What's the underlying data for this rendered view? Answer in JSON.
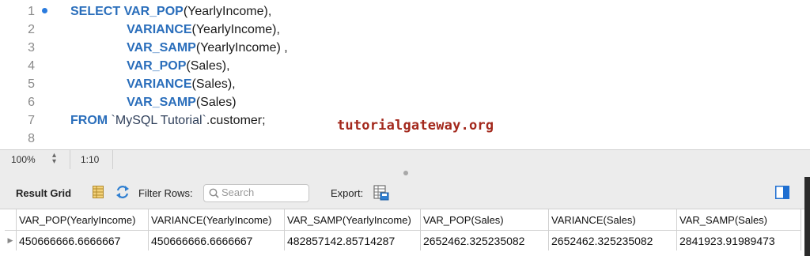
{
  "editor": {
    "line_numbers": [
      "1",
      "2",
      "3",
      "4",
      "5",
      "6",
      "7",
      "8"
    ],
    "lines": [
      {
        "kw": "SELECT ",
        "pre": "",
        "fn": "VAR_POP",
        "rest": "(YearlyIncome),"
      },
      {
        "kw": "",
        "pre": "                ",
        "fn": "VARIANCE",
        "rest": "(YearlyIncome),"
      },
      {
        "kw": "",
        "pre": "                ",
        "fn": "VAR_SAMP",
        "rest": "(YearlyIncome) ,"
      },
      {
        "kw": "",
        "pre": "                ",
        "fn": "VAR_POP",
        "rest": "(Sales),"
      },
      {
        "kw": "",
        "pre": "                ",
        "fn": "VARIANCE",
        "rest": "(Sales),"
      },
      {
        "kw": "",
        "pre": "                ",
        "fn": "VAR_SAMP",
        "rest": "(Sales)"
      },
      {
        "kw": "FROM ",
        "pre": "",
        "fn": "",
        "str": "`MySQL Tutorial`",
        "rest": ".customer;"
      }
    ],
    "watermark": "tutorialgateway.org"
  },
  "statusbar": {
    "zoom": "100%",
    "cursor_position": "1:10"
  },
  "toolbar": {
    "result_grid_label": "Result Grid",
    "filter_rows_label": "Filter Rows:",
    "search_placeholder": "Search",
    "export_label": "Export:"
  },
  "results": {
    "columns": [
      "VAR_POP(YearlyIncome)",
      "VARIANCE(YearlyIncome)",
      "VAR_SAMP(YearlyIncome)",
      "VAR_POP(Sales)",
      "VARIANCE(Sales)",
      "VAR_SAMP(Sales)"
    ],
    "rows": [
      [
        "450666666.6666667",
        "450666666.6666667",
        "482857142.85714287",
        "2652462.325235082",
        "2652462.325235082",
        "2841923.91989473"
      ]
    ]
  },
  "colors": {
    "keyword": "#2a6ebb",
    "watermark": "#a3281c",
    "exec_dot": "#2a7bde"
  }
}
